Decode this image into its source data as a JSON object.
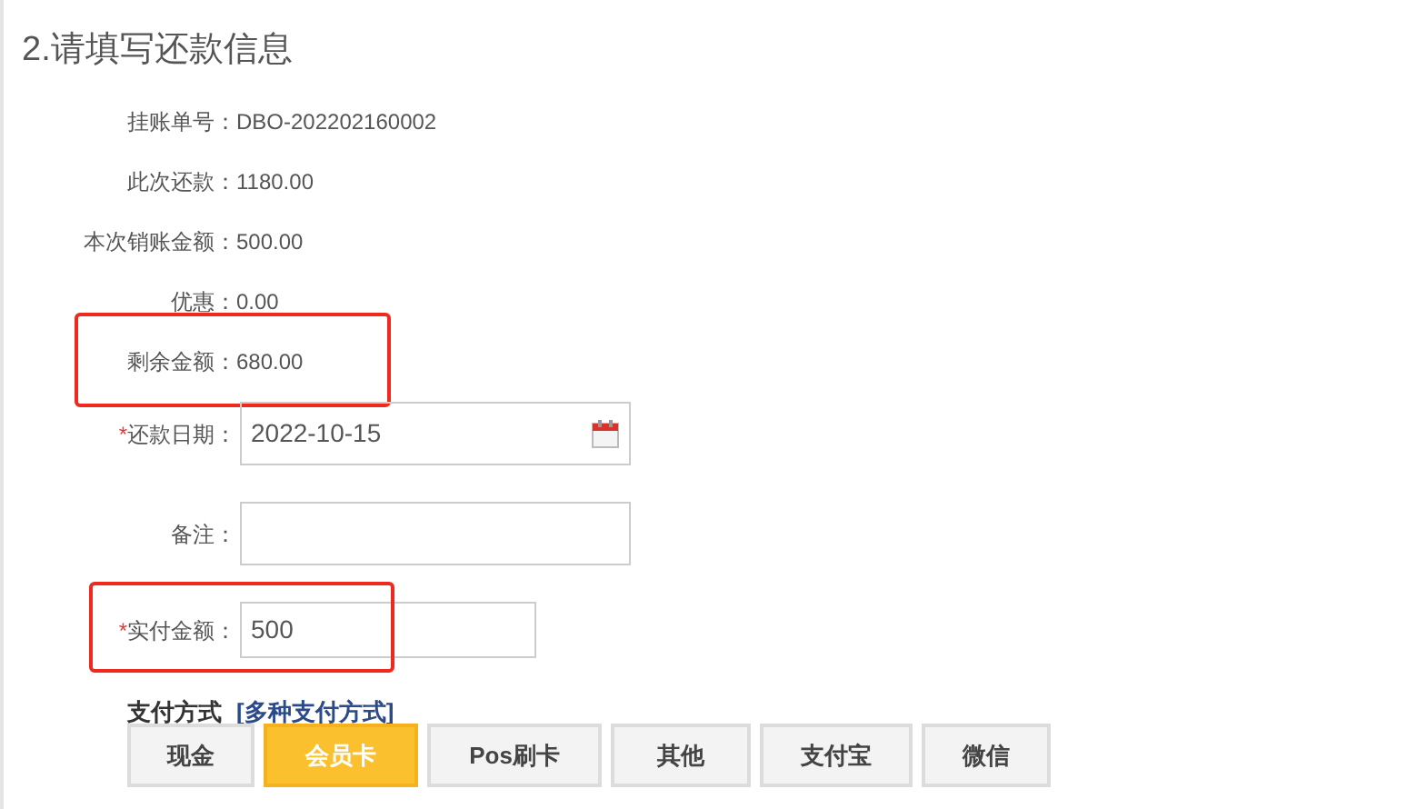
{
  "section_title": "2.请填写还款信息",
  "info_rows": [
    {
      "label": "挂账单号：",
      "value": "DBO-202202160002",
      "highlighted": false
    },
    {
      "label": "此次还款：",
      "value": "1180.00",
      "highlighted": false
    },
    {
      "label": "本次销账金额：",
      "value": "500.00",
      "highlighted": false
    },
    {
      "label": "优惠：",
      "value": "0.00",
      "highlighted": false
    },
    {
      "label": "剩余金额：",
      "value": "680.00",
      "highlighted": true
    }
  ],
  "fields": [
    {
      "kind": "date",
      "required_mark": "*",
      "label": "还款日期：",
      "value": "2022-10-15",
      "highlighted": false
    },
    {
      "kind": "text",
      "label": "备注：",
      "highlighted": false
    },
    {
      "kind": "amount",
      "required_mark": "*",
      "label": "实付金额：",
      "value": "500",
      "highlighted": true
    }
  ],
  "payment": {
    "label": "支付方式",
    "link": "[多种支付方式]",
    "methods": [
      {
        "label": "现金",
        "selected": false
      },
      {
        "label": "会员卡",
        "selected": true
      },
      {
        "label": "Pos刷卡",
        "selected": false
      },
      {
        "label": "其他",
        "selected": false
      },
      {
        "label": "支付宝",
        "selected": false
      },
      {
        "label": "微信",
        "selected": false
      }
    ]
  }
}
